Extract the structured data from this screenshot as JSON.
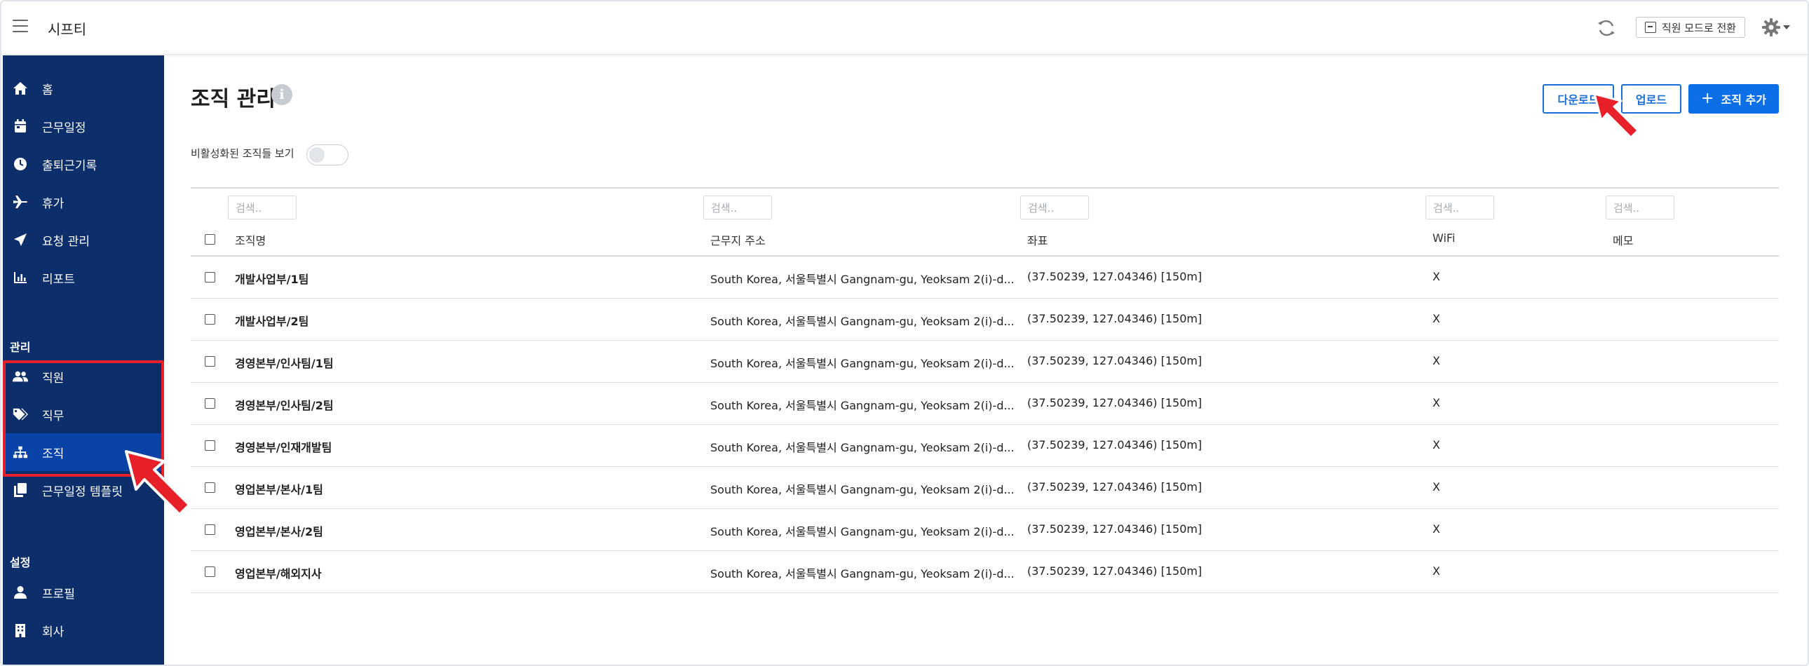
{
  "app": {
    "title": "시프티"
  },
  "header": {
    "mode_switch_label": "직원 모드로 전환"
  },
  "sidebar": {
    "items": [
      {
        "label": "홈",
        "icon": "home-icon"
      },
      {
        "label": "근무일정",
        "icon": "calendar-icon"
      },
      {
        "label": "출퇴근기록",
        "icon": "clock-icon"
      },
      {
        "label": "휴가",
        "icon": "plane-icon"
      },
      {
        "label": "요청 관리",
        "icon": "send-icon"
      },
      {
        "label": "리포트",
        "icon": "chart-icon"
      }
    ],
    "section_manage": "관리",
    "manage_items": [
      {
        "label": "직원",
        "icon": "users-icon"
      },
      {
        "label": "직무",
        "icon": "tags-icon"
      },
      {
        "label": "조직",
        "icon": "org-chart-icon",
        "active": true
      },
      {
        "label": "근무일정 템플릿",
        "icon": "copy-icon"
      }
    ],
    "section_settings": "설정",
    "settings_items": [
      {
        "label": "프로필",
        "icon": "user-icon"
      },
      {
        "label": "회사",
        "icon": "building-icon"
      }
    ]
  },
  "main": {
    "title": "조직 관리",
    "buttons": {
      "download": "다운로드",
      "upload": "업로드",
      "add": "조직 추가"
    },
    "toggle_label": "비활성화된 조직들 보기",
    "toggle_on": false,
    "filter_placeholder": "검색..",
    "columns": [
      "조직명",
      "근무지 주소",
      "좌표",
      "WiFi",
      "메모"
    ],
    "rows": [
      {
        "name": "개발사업부/1팀",
        "address": "South Korea, 서울특별시 Gangnam-gu, Yeoksam 2(i)-d...",
        "coords": "(37.50239, 127.04346) [150m]",
        "wifi": "X",
        "memo": ""
      },
      {
        "name": "개발사업부/2팀",
        "address": "South Korea, 서울특별시 Gangnam-gu, Yeoksam 2(i)-d...",
        "coords": "(37.50239, 127.04346) [150m]",
        "wifi": "X",
        "memo": ""
      },
      {
        "name": "경영본부/인사팀/1팀",
        "address": "South Korea, 서울특별시 Gangnam-gu, Yeoksam 2(i)-d...",
        "coords": "(37.50239, 127.04346) [150m]",
        "wifi": "X",
        "memo": ""
      },
      {
        "name": "경영본부/인사팀/2팀",
        "address": "South Korea, 서울특별시 Gangnam-gu, Yeoksam 2(i)-d...",
        "coords": "(37.50239, 127.04346) [150m]",
        "wifi": "X",
        "memo": ""
      },
      {
        "name": "경영본부/인재개발팀",
        "address": "South Korea, 서울특별시 Gangnam-gu, Yeoksam 2(i)-d...",
        "coords": "(37.50239, 127.04346) [150m]",
        "wifi": "X",
        "memo": ""
      },
      {
        "name": "영업본부/본사/1팀",
        "address": "South Korea, 서울특별시 Gangnam-gu, Yeoksam 2(i)-d...",
        "coords": "(37.50239, 127.04346) [150m]",
        "wifi": "X",
        "memo": ""
      },
      {
        "name": "영업본부/본사/2팀",
        "address": "South Korea, 서울특별시 Gangnam-gu, Yeoksam 2(i)-d...",
        "coords": "(37.50239, 127.04346) [150m]",
        "wifi": "X",
        "memo": ""
      },
      {
        "name": "영업본부/해외지사",
        "address": "South Korea, 서울특별시 Gangnam-gu, Yeoksam 2(i)-d...",
        "coords": "(37.50239, 127.04346) [150m]",
        "wifi": "X",
        "memo": ""
      }
    ]
  },
  "colors": {
    "sidebar_bg": "#0c2f6b",
    "sidebar_active": "#0a43a8",
    "primary": "#0d6fe8",
    "annotation_red": "#e8202a"
  }
}
